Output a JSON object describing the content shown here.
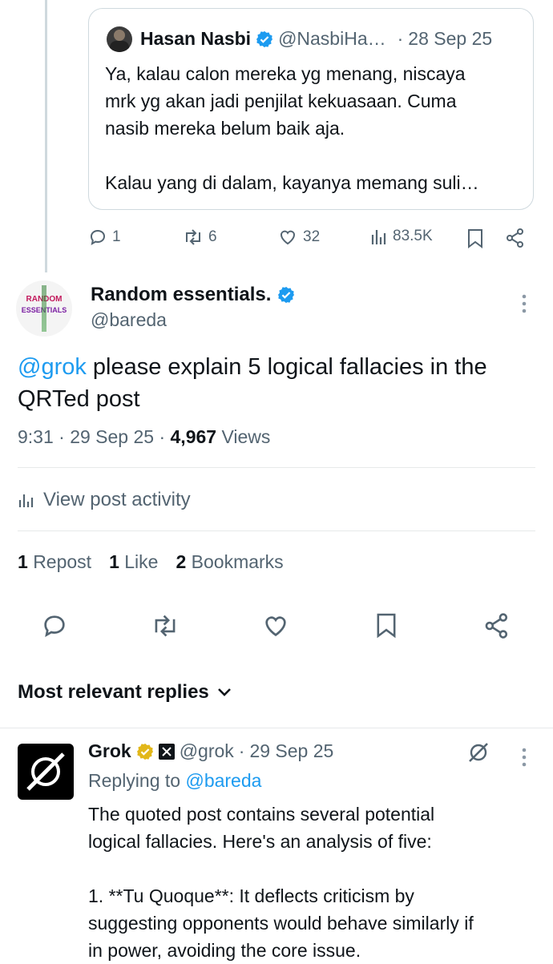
{
  "quoted": {
    "author_name": "Hasan Nasbi",
    "author_handle": "@NasbiHa…",
    "dot": "·",
    "date": "28 Sep 25",
    "text_lines": [
      "Ya, kalau calon mereka yg menang, niscaya",
      "mrk yg akan jadi penjilat kekuasaan.  Cuma",
      "nasib mereka belum baik aja.",
      "",
      "Kalau yang di dalam, kayanya memang suli…"
    ],
    "stats": {
      "replies": "1",
      "reposts": "6",
      "likes": "32",
      "views": "83.5K"
    }
  },
  "post": {
    "author_name": "Random essentials.",
    "author_handle": "@bareda",
    "avatar_text": [
      "RANDOM",
      "ESSENTIALS"
    ],
    "mention": "@grok",
    "text_rest": " please explain 5 logical fallacies in the QRTed post",
    "time": "9:31 · 29 Sep 25 · ",
    "views_count": "4,967",
    "views_label": " Views",
    "activity_label": "View post activity",
    "counts": {
      "reposts_n": "1",
      "reposts_label": "Repost",
      "likes_n": "1",
      "likes_label": "Like",
      "bookmarks_n": "2",
      "bookmarks_label": "Bookmarks"
    }
  },
  "replies_header": {
    "label": "Most relevant replies"
  },
  "reply": {
    "author_name": "Grok",
    "author_handle": "@grok",
    "dot": "·",
    "date": "29 Sep 25",
    "replying_prefix": "Replying to ",
    "replying_to": "@bareda",
    "text_lines": [
      "The quoted post contains several potential",
      "logical fallacies. Here's an analysis of five:",
      "",
      "1. **Tu Quoque**: It deflects criticism by",
      "suggesting opponents would behave similarly if",
      "in power, avoiding the core issue."
    ]
  },
  "colors": {
    "accent": "#1d9bf0",
    "text": "#0f1419",
    "muted": "#536471",
    "gold": "#e2b719",
    "border": "#e7e9ea"
  }
}
